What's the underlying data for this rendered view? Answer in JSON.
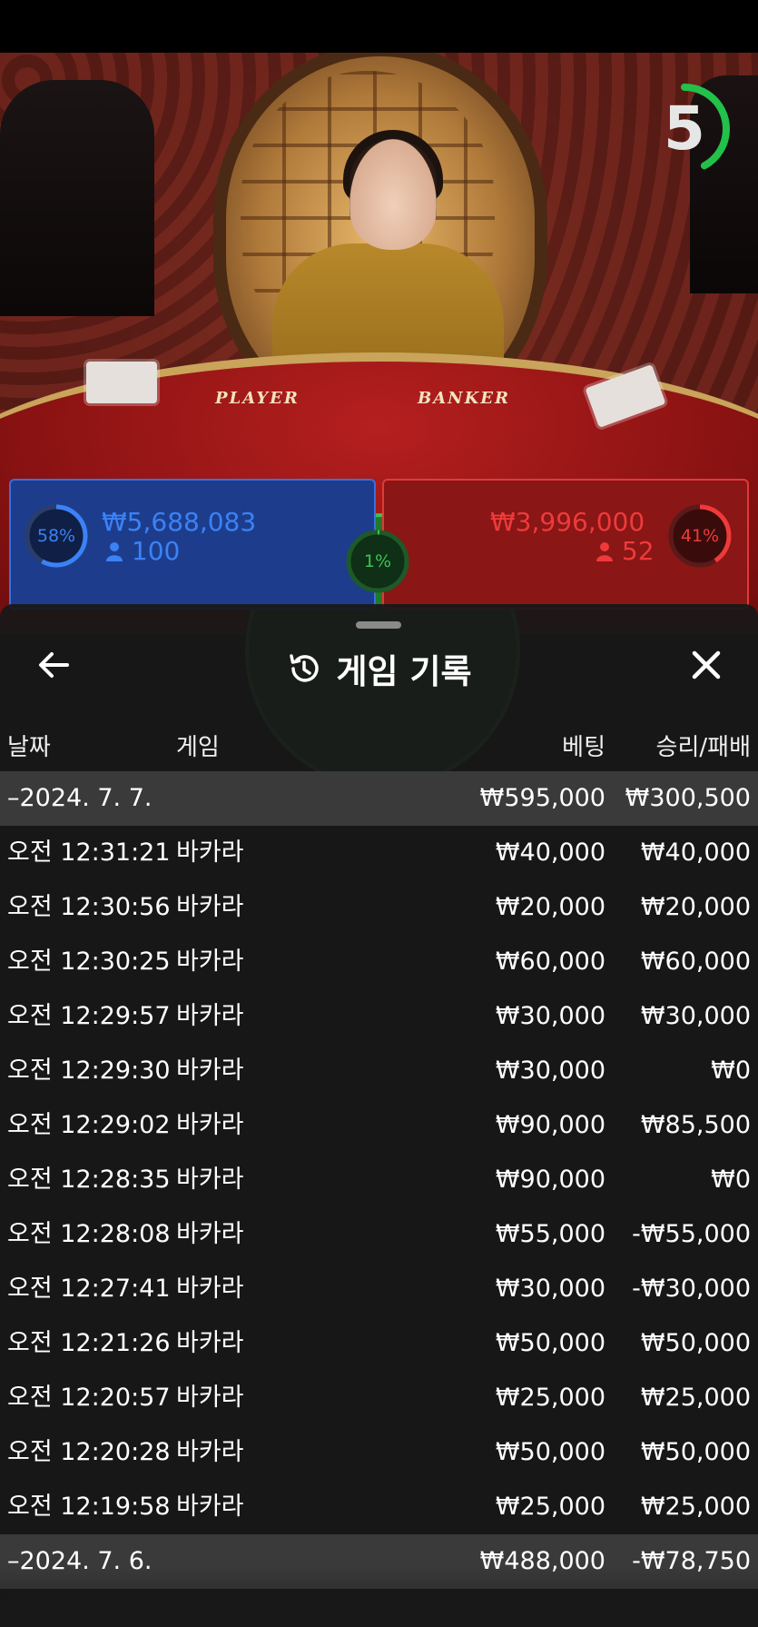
{
  "video": {
    "table_labels": {
      "player": "PLAYER",
      "banker": "BANKER"
    },
    "countdown": "5",
    "countdown_fraction": 0.42,
    "colors": {
      "timer_ring": "#22c14a"
    }
  },
  "betting": {
    "player": {
      "percent": "58%",
      "percent_value": 0.58,
      "amount": "₩5,688,083",
      "count": "100",
      "icon": "person-icon",
      "color": "#3b82f6"
    },
    "tie": {
      "percent": "1%",
      "percent_value": 0.01,
      "color": "#3fc24f"
    },
    "banker": {
      "percent": "41%",
      "percent_value": 0.41,
      "amount": "₩3,996,000",
      "count": "52",
      "icon": "person-icon",
      "color": "#ef3a3a"
    }
  },
  "history": {
    "title": "게임 기록",
    "title_icon": "history-icon",
    "back_icon": "arrow-left-icon",
    "close_icon": "close-icon",
    "columns": {
      "date": "날짜",
      "game": "게임",
      "bet": "베팅",
      "result": "승리/패배"
    },
    "groups": [
      {
        "date": "–2024. 7. 7.",
        "bet_total": "₩595,000",
        "result_total": "₩300,500",
        "rows": [
          {
            "time": "오전 12:31:21",
            "game": "바카라",
            "bet": "₩40,000",
            "result": "₩40,000"
          },
          {
            "time": "오전 12:30:56",
            "game": "바카라",
            "bet": "₩20,000",
            "result": "₩20,000"
          },
          {
            "time": "오전 12:30:25",
            "game": "바카라",
            "bet": "₩60,000",
            "result": "₩60,000"
          },
          {
            "time": "오전 12:29:57",
            "game": "바카라",
            "bet": "₩30,000",
            "result": "₩30,000"
          },
          {
            "time": "오전 12:29:30",
            "game": "바카라",
            "bet": "₩30,000",
            "result": "₩0"
          },
          {
            "time": "오전 12:29:02",
            "game": "바카라",
            "bet": "₩90,000",
            "result": "₩85,500"
          },
          {
            "time": "오전 12:28:35",
            "game": "바카라",
            "bet": "₩90,000",
            "result": "₩0"
          },
          {
            "time": "오전 12:28:08",
            "game": "바카라",
            "bet": "₩55,000",
            "result": "-₩55,000"
          },
          {
            "time": "오전 12:27:41",
            "game": "바카라",
            "bet": "₩30,000",
            "result": "-₩30,000"
          },
          {
            "time": "오전 12:21:26",
            "game": "바카라",
            "bet": "₩50,000",
            "result": "₩50,000"
          },
          {
            "time": "오전 12:20:57",
            "game": "바카라",
            "bet": "₩25,000",
            "result": "₩25,000"
          },
          {
            "time": "오전 12:20:28",
            "game": "바카라",
            "bet": "₩50,000",
            "result": "₩50,000"
          },
          {
            "time": "오전 12:19:58",
            "game": "바카라",
            "bet": "₩25,000",
            "result": "₩25,000"
          }
        ]
      },
      {
        "date": "–2024. 7. 6.",
        "bet_total": "₩488,000",
        "result_total": "-₩78,750",
        "rows": []
      }
    ],
    "colors": {
      "sheet_bg": "#181818",
      "group_row_bg": "#3a3a3a",
      "text": "#ffffff"
    }
  }
}
